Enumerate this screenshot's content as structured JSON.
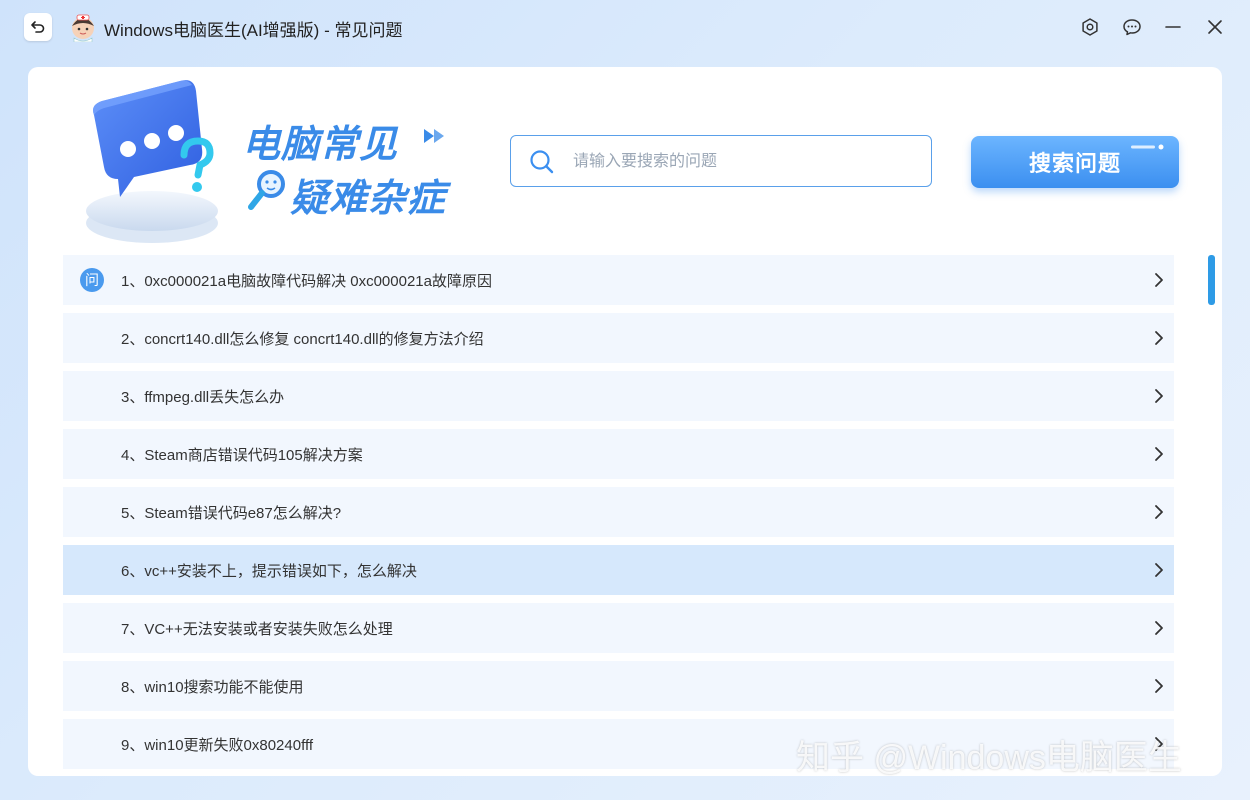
{
  "window": {
    "title": "Windows电脑医生(AI增强版) - 常见问题",
    "icons": {
      "back": "back-arrow-icon",
      "settings": "settings-icon",
      "feedback": "chat-icon",
      "minimize": "minimize-icon",
      "close": "close-icon"
    }
  },
  "hero": {
    "line1": "电脑常见",
    "line2": "疑难杂症"
  },
  "search": {
    "placeholder": "请输入要搜索的问题",
    "value": "",
    "button_label": "搜索问题"
  },
  "faq": {
    "badge": "问",
    "items": [
      {
        "label": "1、0xc000021a电脑故障代码解决 0xc000021a故障原因"
      },
      {
        "label": "2、concrt140.dll怎么修复 concrt140.dll的修复方法介绍"
      },
      {
        "label": "3、ffmpeg.dll丢失怎么办"
      },
      {
        "label": "4、Steam商店错误代码105解决方案"
      },
      {
        "label": "5、Steam错误代码e87怎么解决?"
      },
      {
        "label": "6、vc++安装不上，提示错误如下，怎么解决"
      },
      {
        "label": "7、VC++无法安装或者安装失败怎么处理"
      },
      {
        "label": "8、win10搜索功能不能使用"
      },
      {
        "label": "9、win10更新失败0x80240fff"
      }
    ]
  },
  "watermark": "知乎 @Windows电脑医生",
  "colors": {
    "accent": "#3b8ff0",
    "row_bg": "#f2f7fe",
    "row_active": "#d6e8fc",
    "scroll_thumb": "#2e9be6"
  }
}
